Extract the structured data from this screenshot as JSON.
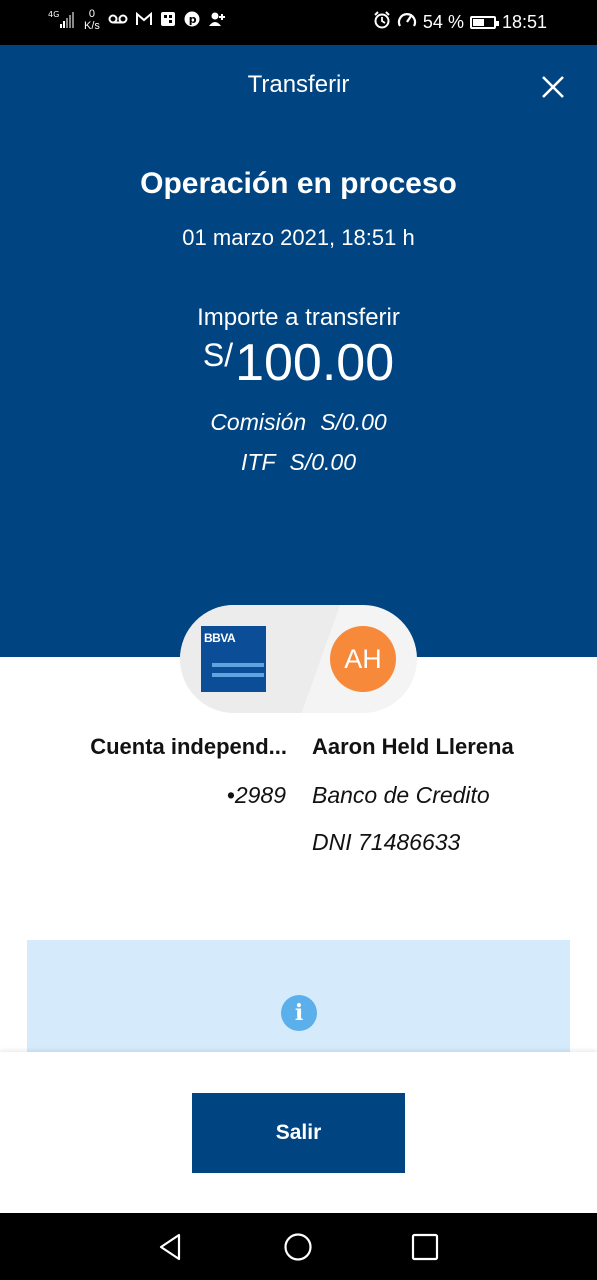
{
  "status_bar": {
    "network": "4G",
    "net_speed_value": "0",
    "net_speed_unit": "K/s",
    "battery_text": "54 %",
    "battery_level": 0.54,
    "time": "18:51",
    "left_icons": [
      "signal-icon",
      "voicemail-icon",
      "gmail-icon",
      "app-icon",
      "pinterest-icon",
      "add-contact-icon"
    ],
    "right_icons": [
      "alarm-icon",
      "data-saver-icon",
      "battery-icon"
    ]
  },
  "header": {
    "title": "Transferir",
    "close_icon": "close-icon",
    "operation_title": "Operación en proceso",
    "date": "01 marzo 2021, 18:51 h",
    "amount_label": "Importe a transferir",
    "currency": "S/",
    "amount": "100.00",
    "commission_label": "Comisión",
    "commission_value": "S/0.00",
    "itf_label": "ITF",
    "itf_value": "S/0.00",
    "background_color": "#004481"
  },
  "transfer": {
    "bank_logo_text": "BBVA",
    "avatar_initials": "AH",
    "avatar_color": "#f7893b",
    "origin_account_name": "Cuenta independ...",
    "origin_account_number": "•2989",
    "payee_name": "Aaron Held Llerena",
    "payee_bank": "Banco de Credito",
    "payee_document": "DNI 71486633"
  },
  "info": {
    "icon": "info-icon",
    "icon_glyph": "i"
  },
  "footer": {
    "exit_button_label": "Salir"
  },
  "nav_bar": {
    "buttons": [
      "back-icon",
      "home-icon",
      "recents-icon"
    ]
  }
}
